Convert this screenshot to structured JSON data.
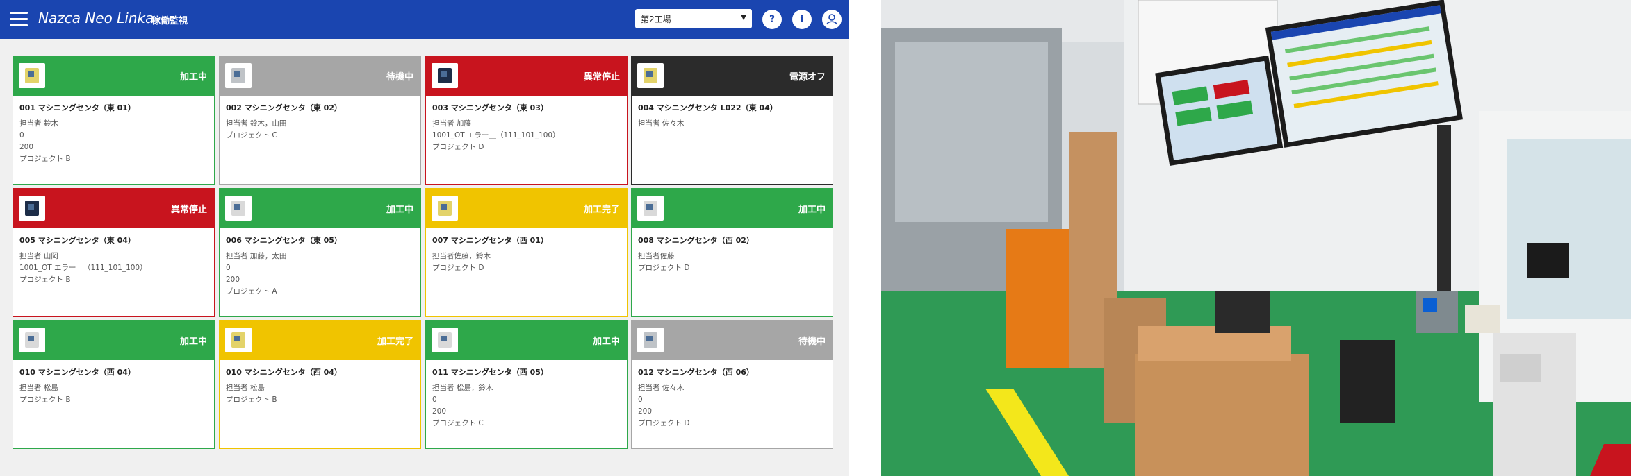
{
  "app": {
    "brand": "Nazca Neo Linka",
    "page_title": "稼働監視",
    "factory_select": {
      "value": "第2工場"
    },
    "buttons": {
      "help": "?",
      "info": "i"
    },
    "colors": {
      "header": "#1a45b0",
      "running": "#2ea84a",
      "waiting": "#a6a6a6",
      "alarm": "#c8141e",
      "off": "#2b2b2b",
      "complete": "#f0c400"
    }
  },
  "machines": [
    {
      "status": "加工中",
      "status_key": "running",
      "name": "001 マシニングセンタ（東 01）",
      "lines": [
        "担当者 鈴木",
        "0",
        "200",
        "プロジェクト B"
      ]
    },
    {
      "status": "待機中",
      "status_key": "waiting",
      "name": "002 マシニングセンタ（東 02）",
      "lines": [
        "担当者 鈴木，山田",
        "プロジェクト C"
      ]
    },
    {
      "status": "異常停止",
      "status_key": "alarm",
      "name": "003 マシニングセンタ（東 03）",
      "lines": [
        "担当者 加藤",
        "1001_OT エラー＿（111_101_100）",
        "プロジェクト D"
      ]
    },
    {
      "status": "電源オフ",
      "status_key": "off",
      "name": "004 マシニングセンタ L022（東 04）",
      "lines": [
        "担当者 佐々木"
      ]
    },
    {
      "status": "異常停止",
      "status_key": "alarm",
      "name": "005 マシニングセンタ（東 04）",
      "lines": [
        "担当者 山岡",
        "1001_OT エラー＿（111_101_100）",
        "プロジェクト B"
      ]
    },
    {
      "status": "加工中",
      "status_key": "running",
      "name": "006 マシニングセンタ（東 05）",
      "lines": [
        "担当者 加藤，太田",
        "0",
        "200",
        "プロジェクト A"
      ]
    },
    {
      "status": "加工完了",
      "status_key": "complete",
      "name": "007 マシニングセンタ（西 01）",
      "lines": [
        "担当者佐藤，鈴木",
        "プロジェクト D"
      ]
    },
    {
      "status": "加工中",
      "status_key": "running",
      "name": "008 マシニングセンタ（西 02）",
      "lines": [
        "担当者佐藤",
        "プロジェクト D"
      ]
    },
    {
      "status": "加工中",
      "status_key": "running",
      "name": "010 マシニングセンタ（西 04）",
      "lines": [
        "担当者 松島",
        "プロジェクト B"
      ]
    },
    {
      "status": "加工完了",
      "status_key": "complete",
      "name": "010 マシニングセンタ（西 04）",
      "lines": [
        "担当者 松島",
        "プロジェクト B"
      ]
    },
    {
      "status": "加工中",
      "status_key": "running",
      "name": "011 マシニングセンタ（西 05）",
      "lines": [
        "担当者 松島，鈴木",
        "0",
        "200",
        "プロジェクト C"
      ]
    },
    {
      "status": "待機中",
      "status_key": "waiting",
      "name": "012 マシニングセンタ（西 06）",
      "lines": [
        "担当者 佐々木",
        "0",
        "200",
        "プロジェクト D"
      ]
    }
  ]
}
